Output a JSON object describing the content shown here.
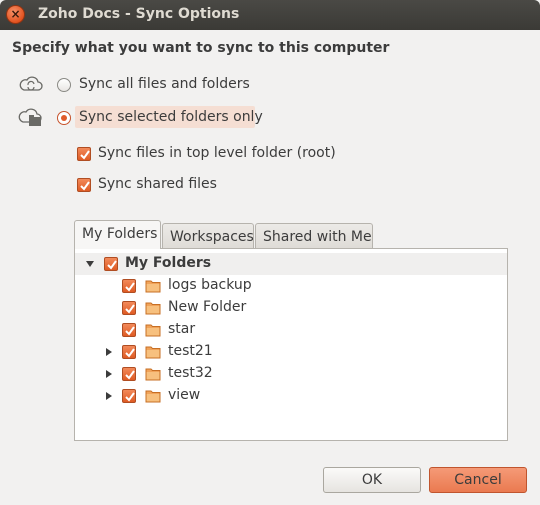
{
  "window": {
    "title": "Zoho Docs - Sync Options",
    "close_symbol": "×"
  },
  "heading": "Specify what you want to sync to this computer",
  "sync_mode": {
    "options": [
      {
        "label": "Sync all files and folders",
        "icon": "cloud-sync-icon",
        "selected": false
      },
      {
        "label": "Sync selected folders only",
        "icon": "cloud-folder-icon",
        "selected": true
      }
    ]
  },
  "checkboxes": [
    {
      "label": "Sync files in top level folder (root)",
      "checked": true
    },
    {
      "label": "Sync shared files",
      "checked": true
    }
  ],
  "tabs": [
    {
      "label": "My Folders",
      "active": true
    },
    {
      "label": "Workspaces",
      "active": false
    },
    {
      "label": "Shared with Me",
      "active": false
    }
  ],
  "tree": {
    "root": {
      "label": "My Folders",
      "checked": true,
      "expanded": true
    },
    "folders": [
      {
        "label": "logs backup",
        "checked": true,
        "expandable": false
      },
      {
        "label": "New Folder",
        "checked": true,
        "expandable": false
      },
      {
        "label": "star",
        "checked": true,
        "expandable": false
      },
      {
        "label": "test21",
        "checked": true,
        "expandable": true
      },
      {
        "label": "test32",
        "checked": true,
        "expandable": true
      },
      {
        "label": "view",
        "checked": true,
        "expandable": true
      }
    ]
  },
  "buttons": {
    "ok": "OK",
    "cancel": "Cancel"
  },
  "colors": {
    "accent": "#e05b2a",
    "titlebar": "#3c3b37",
    "background": "#f2f1f0"
  }
}
